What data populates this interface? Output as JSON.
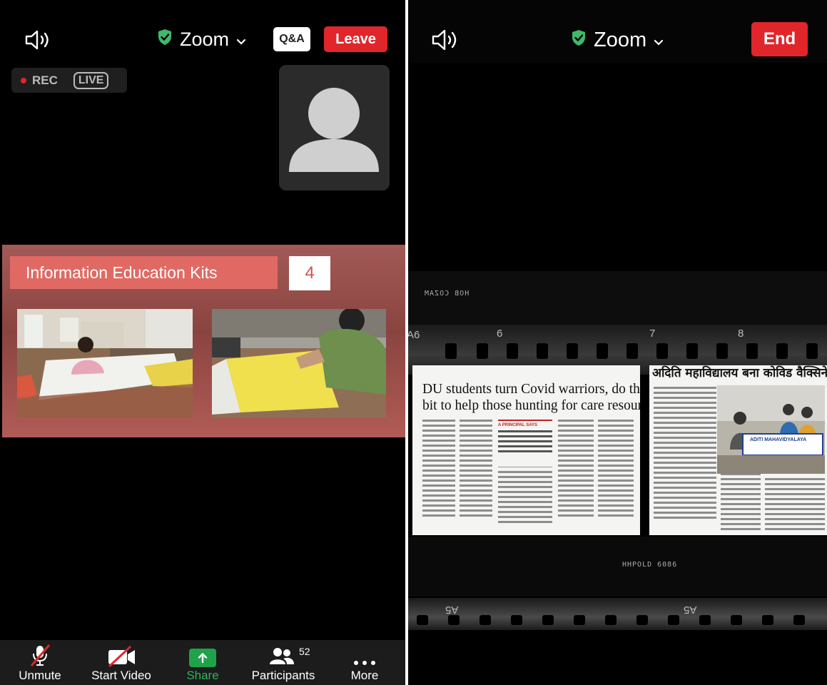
{
  "left_screen": {
    "app_title": "Zoom",
    "qa_button": "Q&A",
    "leave_button": "Leave",
    "rec_label": "REC",
    "live_label": "LIVE",
    "slide": {
      "title": "Information Education Kits",
      "number": "4"
    },
    "toolbar": {
      "unmute": "Unmute",
      "start_video": "Start Video",
      "share": "Share",
      "participants": "Participants",
      "participants_count": "52",
      "more": "More"
    }
  },
  "right_screen": {
    "app_title": "Zoom",
    "end_button": "End",
    "clipping1_headline_line1": "DU students turn Covid warriors, do their",
    "clipping1_headline_line2": "bit to help those hunting for care resources",
    "clipping1_pullquote_label": "A PRINCIPAL SAYS",
    "clipping2_headline": "अदिति महाविद्यालय बना कोविड वैक्सिनेशन सेंटर",
    "clipping2_banner": "ADITI MAHAVIDYALAYA",
    "film_marks": {
      "top_code": "HOB COZAM",
      "frame_a": "6",
      "frame_b": "7",
      "frame_c": "8",
      "side": "A6",
      "bottom_code": "HHPOLD 6086",
      "lower_a": "A5",
      "lower_b": "A5"
    }
  },
  "colors": {
    "red_button": "#e0262b",
    "share_green": "#1fa34a",
    "shield_green": "#3fb86a",
    "slide_title_bg": "#e06a63"
  },
  "icons": [
    "speaker-icon",
    "shield-check-icon",
    "chevron-down-icon",
    "muted-mic-icon",
    "video-off-icon",
    "share-arrow-icon",
    "participants-icon",
    "more-dots-icon",
    "avatar-placeholder-icon"
  ]
}
